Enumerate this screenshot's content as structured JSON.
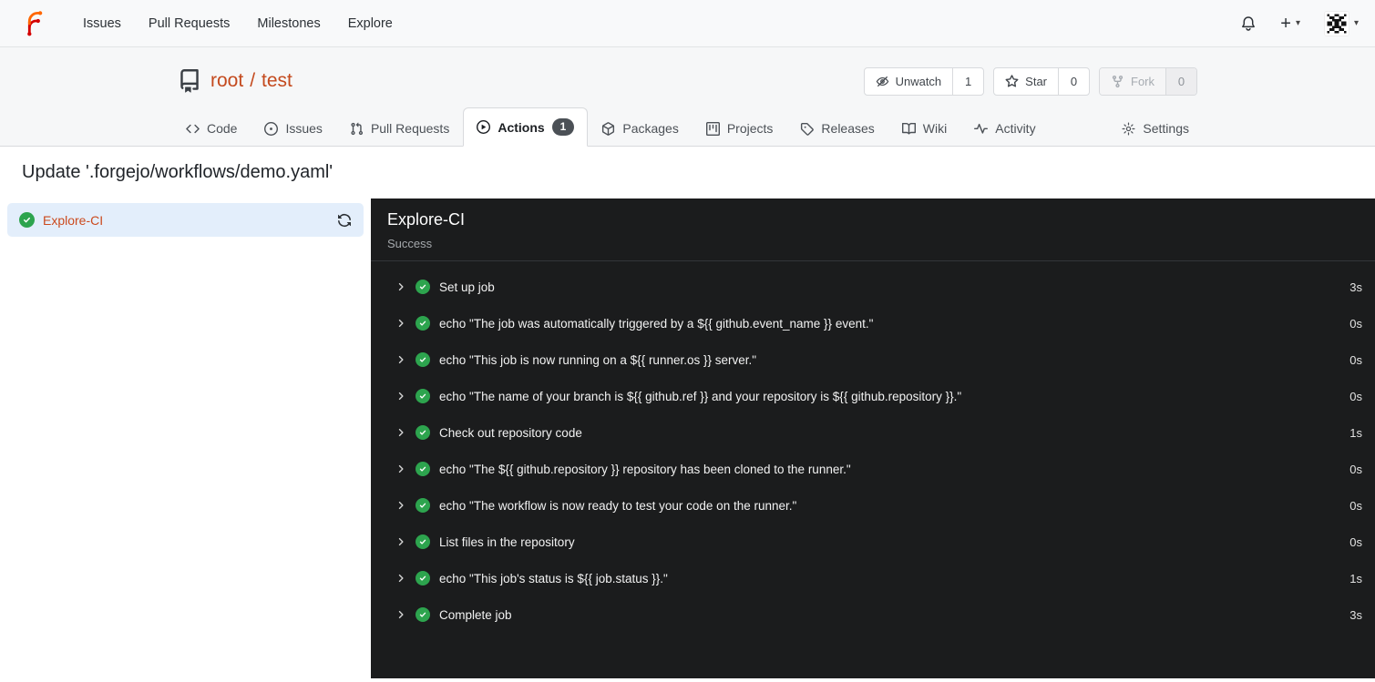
{
  "navbar": {
    "links": [
      "Issues",
      "Pull Requests",
      "Milestones",
      "Explore"
    ],
    "create_label": "+",
    "caret": "▾",
    "icons": [
      "forgejo-logo",
      "bell-icon",
      "plus-icon",
      "avatar-identicon"
    ]
  },
  "repo_header": {
    "owner": "root",
    "separator": "/",
    "name": "test",
    "actions": {
      "unwatch": {
        "label": "Unwatch",
        "count": "1"
      },
      "star": {
        "label": "Star",
        "count": "0"
      },
      "fork": {
        "label": "Fork",
        "count": "0",
        "disabled": true
      }
    },
    "tabs": [
      {
        "label": "Code"
      },
      {
        "label": "Issues"
      },
      {
        "label": "Pull Requests"
      },
      {
        "label": "Actions",
        "badge": "1",
        "active": true
      },
      {
        "label": "Packages"
      },
      {
        "label": "Projects"
      },
      {
        "label": "Releases"
      },
      {
        "label": "Wiki"
      },
      {
        "label": "Activity"
      },
      {
        "label": "Settings"
      }
    ]
  },
  "run": {
    "title": "Update '.forgejo/workflows/demo.yaml'",
    "sidebar_job": {
      "name": "Explore-CI",
      "status": "success"
    },
    "detail": {
      "job_name": "Explore-CI",
      "status_text": "Success",
      "steps": [
        {
          "name": "Set up job",
          "duration": "3s"
        },
        {
          "name": "echo \"The job was automatically triggered by a ${{ github.event_name }} event.\"",
          "duration": "0s"
        },
        {
          "name": "echo \"This job is now running on a ${{ runner.os }} server.\"",
          "duration": "0s"
        },
        {
          "name": "echo \"The name of your branch is ${{ github.ref }} and your repository is ${{ github.repository }}.\"",
          "duration": "0s"
        },
        {
          "name": "Check out repository code",
          "duration": "1s"
        },
        {
          "name": "echo \"The ${{ github.repository }} repository has been cloned to the runner.\"",
          "duration": "0s"
        },
        {
          "name": "echo \"The workflow is now ready to test your code on the runner.\"",
          "duration": "0s"
        },
        {
          "name": "List files in the repository",
          "duration": "0s"
        },
        {
          "name": "echo \"This job's status is ${{ job.status }}.\"",
          "duration": "1s"
        },
        {
          "name": "Complete job",
          "duration": "3s"
        }
      ]
    }
  },
  "colors": {
    "accent_orange": "#c44a1e",
    "success_green": "#2da44e",
    "log_panel_bg": "#1b1c1d",
    "active_job_bg": "#e3eefb",
    "badge_bg": "#4b5056"
  }
}
